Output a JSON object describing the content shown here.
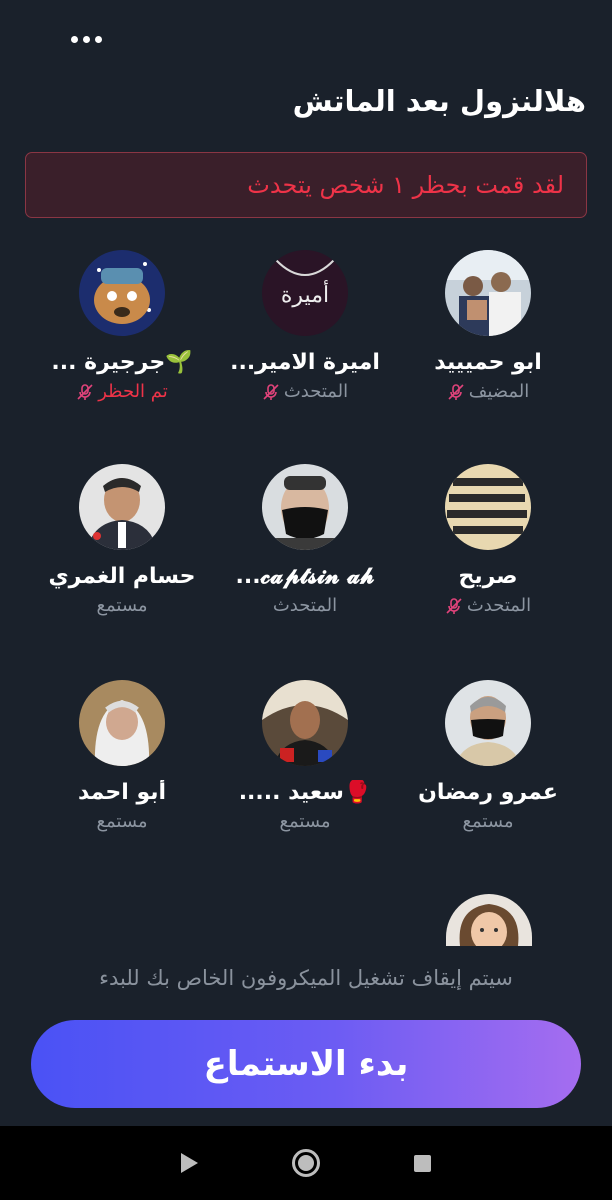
{
  "header": {
    "more_label": "...",
    "title": "هلالنزول بعد الماتش"
  },
  "banner": {
    "text": "لقد قمت بحظر ١ شخص يتحدث"
  },
  "members": [
    {
      "name": "ابو حميييد",
      "role": "المضيف",
      "muted": true,
      "banned": false,
      "avatar": "avatar-photo-group"
    },
    {
      "name": "اميرة الامير...",
      "role": "المتحدث",
      "muted": true,
      "banned": false,
      "avatar": "avatar-name-necklace"
    },
    {
      "name": "🌱جرجيرة ...",
      "role": "تم الحظر",
      "muted": true,
      "banned": true,
      "avatar": "avatar-cartoon-dog"
    },
    {
      "name": "صريح",
      "role": "المتحدث",
      "muted": true,
      "banned": false,
      "avatar": "avatar-text-image"
    },
    {
      "name": "𝓬𝓪𝓹𝓽𝓼𝓲𝓷 𝓪𝓱...",
      "role": "المتحدث",
      "muted": false,
      "banned": false,
      "avatar": "avatar-masked-man"
    },
    {
      "name": "حسام الغمري",
      "role": "مستمع",
      "muted": false,
      "banned": false,
      "avatar": "avatar-man-suit"
    },
    {
      "name": "عمرو رمضان",
      "role": "مستمع",
      "muted": false,
      "banned": false,
      "avatar": "avatar-man-mask"
    },
    {
      "name": "🥊سعيد .....",
      "role": "مستمع",
      "muted": false,
      "banned": false,
      "avatar": "avatar-young-man"
    },
    {
      "name": "أبو احمد",
      "role": "مستمع",
      "muted": false,
      "banned": false,
      "avatar": "avatar-elderly-woman"
    }
  ],
  "footer": {
    "notice": "سيتم إيقاف تشغيل الميكروفون الخاص بك للبدء",
    "start_button": "بدء الاستماع"
  },
  "colors": {
    "background": "#1a212b",
    "banner_text": "#ee3348",
    "muted_icon": "#e0437a",
    "button_gradient_start": "#4a52f5",
    "button_gradient_end": "#a56df0"
  }
}
